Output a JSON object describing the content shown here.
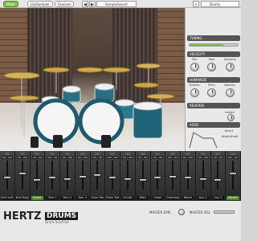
{
  "toolbar": {
    "mixer_button": "Mixer",
    "library_button": "Lib/Sampler",
    "grooves_button": "Grooves",
    "preset_name": "SampleSound",
    "preset_search_placeholder": "Drums"
  },
  "right_panel": {
    "tuning": {
      "label": "TUNING",
      "value": 0.7
    },
    "velocity": {
      "label": "VELOCITY",
      "knobs": [
        "Min",
        "Max",
        "Dynamic"
      ],
      "extra": "On"
    },
    "humanize": {
      "label": "HUMANIZE",
      "knobs": [
        "Volume",
        "Pitch",
        "Velocity"
      ]
    },
    "reverse": {
      "label": "REVERSE",
      "option": "Length"
    },
    "adsr": {
      "label": "ADSR",
      "mode": "Direct",
      "sub": "Attack/Hold",
      "attack": "Attack"
    }
  },
  "mixer": {
    "channels": [
      {
        "label": "Kick Left",
        "green": false,
        "level": 0.4
      },
      {
        "label": "Kick Right",
        "green": false,
        "level": 0.55
      },
      {
        "label": "Snare",
        "green": true,
        "level": 0.3
      },
      {
        "label": "Tom 1",
        "green": false,
        "level": 0.4
      },
      {
        "label": "Tom 2",
        "green": false,
        "level": 0.35
      },
      {
        "label": "Tom 3",
        "green": false,
        "level": 0.45
      },
      {
        "label": "Floor Tom 1",
        "green": false,
        "level": 0.5
      },
      {
        "label": "Floor Tom 2",
        "green": false,
        "level": 0.4
      },
      {
        "label": "Hi-Hat",
        "green": false,
        "level": 0.35
      },
      {
        "label": "Ride",
        "green": false,
        "level": 0.3
      },
      {
        "label": "Crash",
        "green": false,
        "level": 0.4
      },
      {
        "label": "Overhead",
        "green": false,
        "level": 0.45
      },
      {
        "label": "Room",
        "green": false,
        "level": 0.4
      },
      {
        "label": "Aux 1",
        "green": false,
        "level": 0.35
      },
      {
        "label": "Aux 2",
        "green": false,
        "level": 0.3
      },
      {
        "label": "Master",
        "green": true,
        "level": 0.55
      }
    ]
  },
  "footer": {
    "logo": "HERTZ",
    "logo_badge": "DRUMS",
    "logo_sub": "Drum machine",
    "master_dyn": "MASTER DYN",
    "master_vol": "MASTER VOL"
  }
}
